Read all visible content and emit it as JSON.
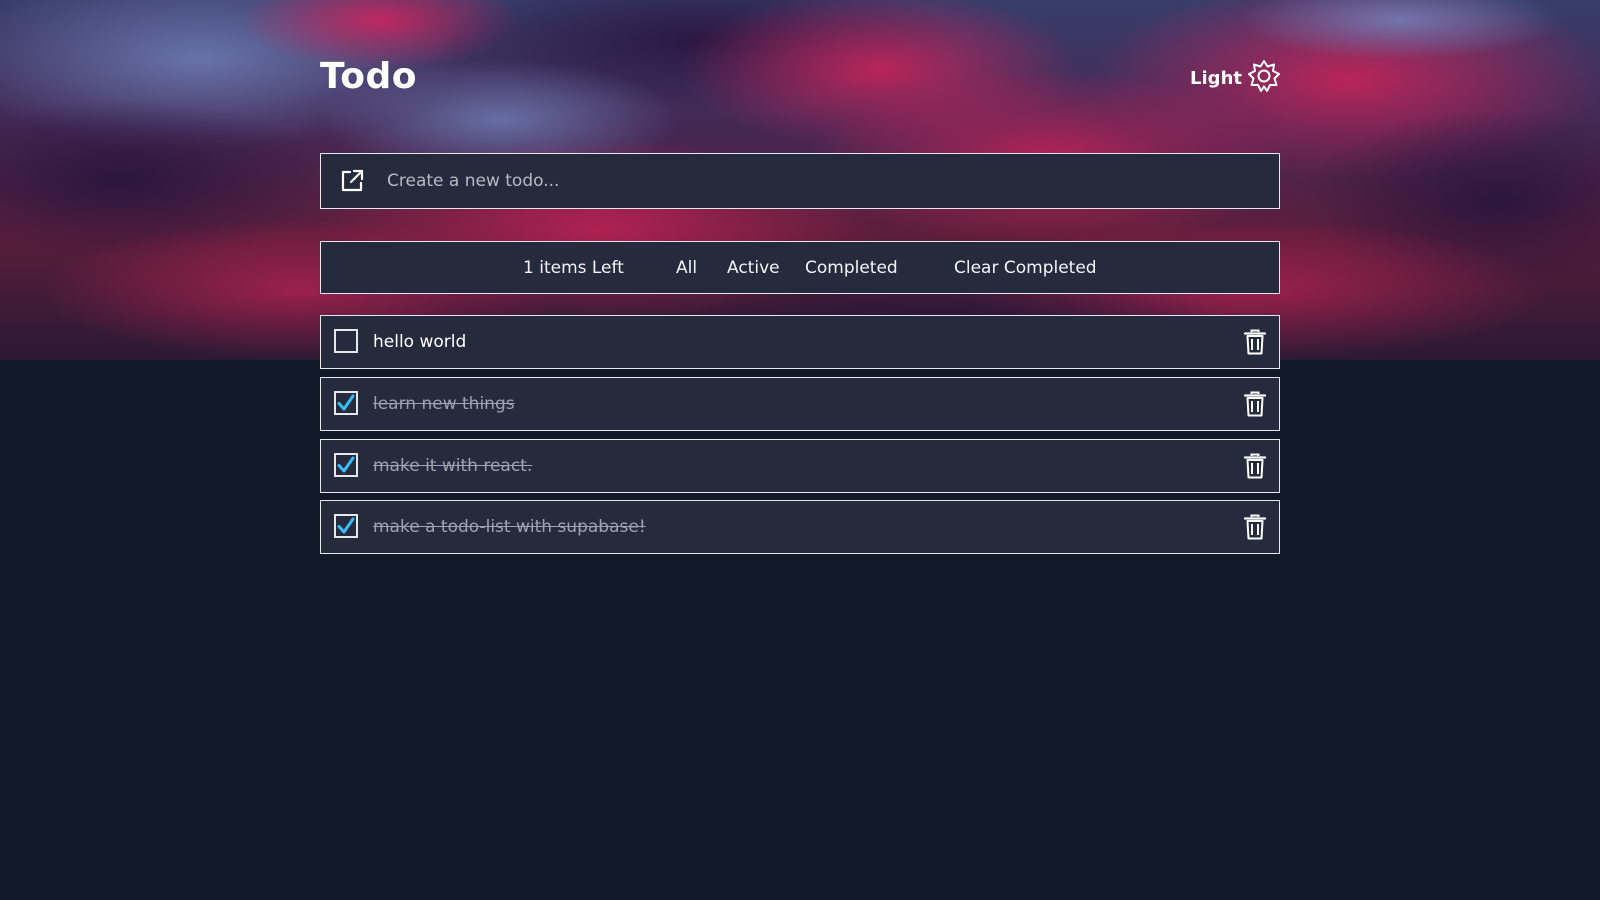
{
  "app": {
    "title": "Todo"
  },
  "theme_toggle": {
    "label": "Light",
    "icon": "sun-icon"
  },
  "new_todo": {
    "placeholder": "Create a new todo...",
    "icon": "external-edit-icon"
  },
  "filters": {
    "items_left": "1 items Left",
    "all": "All",
    "active": "Active",
    "completed": "Completed",
    "clear_completed": "Clear Completed"
  },
  "todos": [
    {
      "text": "hello world",
      "completed": false
    },
    {
      "text": "learn new things",
      "completed": true
    },
    {
      "text": "make it with react.",
      "completed": true
    },
    {
      "text": "make a todo-list with supabase!",
      "completed": true
    }
  ],
  "colors": {
    "background": "#111827",
    "card": "#252b3d",
    "border": "#e5e7eb",
    "check_accent": "#38bdf8"
  }
}
